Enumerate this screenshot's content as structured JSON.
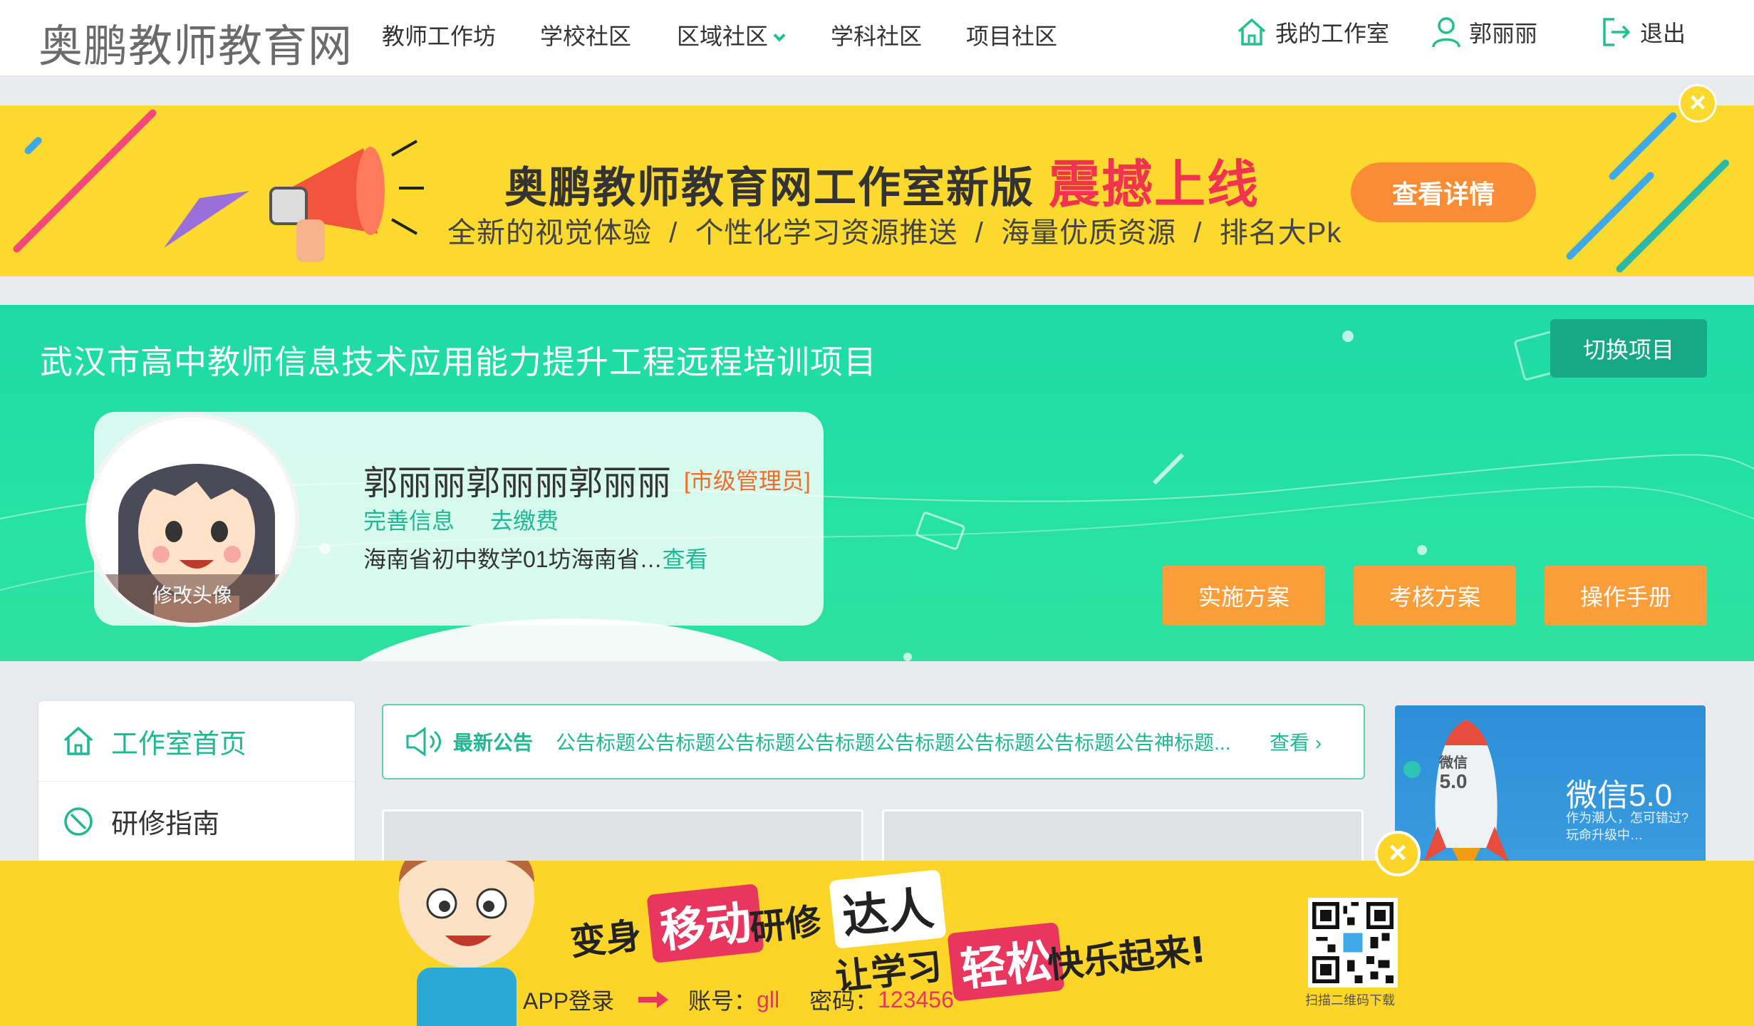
{
  "nav": {
    "logo": "奥鹏教师教育网",
    "links": [
      "教师工作坊",
      "学校社区",
      "区域社区",
      "学科社区",
      "项目社区"
    ],
    "my_studio": "我的工作室",
    "user": "郭丽丽",
    "logout": "退出"
  },
  "banner": {
    "title": "奥鹏教师教育网工作室新版",
    "title_highlight": "震撼上线",
    "subtitle": "全新的视觉体验  /  个性化学习资源推送  /  海量优质资源  /  排名大Pk",
    "button": "查看详情",
    "close": "×"
  },
  "project": {
    "title": "武汉市高中教师信息技术应用能力提升工程远程培训项目",
    "switch_button": "切换项目",
    "avatar_edit": "修改头像",
    "user_name": "郭丽丽郭丽丽郭丽丽",
    "user_role": "[市级管理员]",
    "link_profile": "完善信息",
    "link_pay": "去缴费",
    "org": "海南省初中数学01坊海南省…",
    "org_more": "查看",
    "buttons": [
      "实施方案",
      "考核方案",
      "操作手册"
    ]
  },
  "sidebar": {
    "items": [
      {
        "label": "工作室首页",
        "active": true
      },
      {
        "label": "研修指南",
        "active": false
      }
    ]
  },
  "notice": {
    "label": "最新公告",
    "text": "公告标题公告标题公告标题公告标题公告标题公告标题公告标题公告神标题...",
    "more": "查看"
  },
  "promo": {
    "title": "微信5.0",
    "subtitle_line1": "作为潮人，怎可错过?",
    "subtitle_line2": "玩命升级中…",
    "rocket_label_1": "微信",
    "rocket_label_2": "5.0"
  },
  "app_banner": {
    "word1": "变身",
    "word2": "移动",
    "word3": "研修",
    "word4": "达人",
    "word5": "让学习",
    "word6": "轻松",
    "word7": "快乐起来!",
    "login_label": "APP登录",
    "account_label": "账号：",
    "account_value": "gll",
    "password_label": "密码：",
    "password_value": "123456",
    "qr_caption": "扫描二维码下载",
    "close": "×"
  },
  "colors": {
    "accent_green": "#1fb893",
    "banner_yellow": "#fbd92f",
    "orange": "#fb9e3a",
    "pink": "#e8365f"
  }
}
